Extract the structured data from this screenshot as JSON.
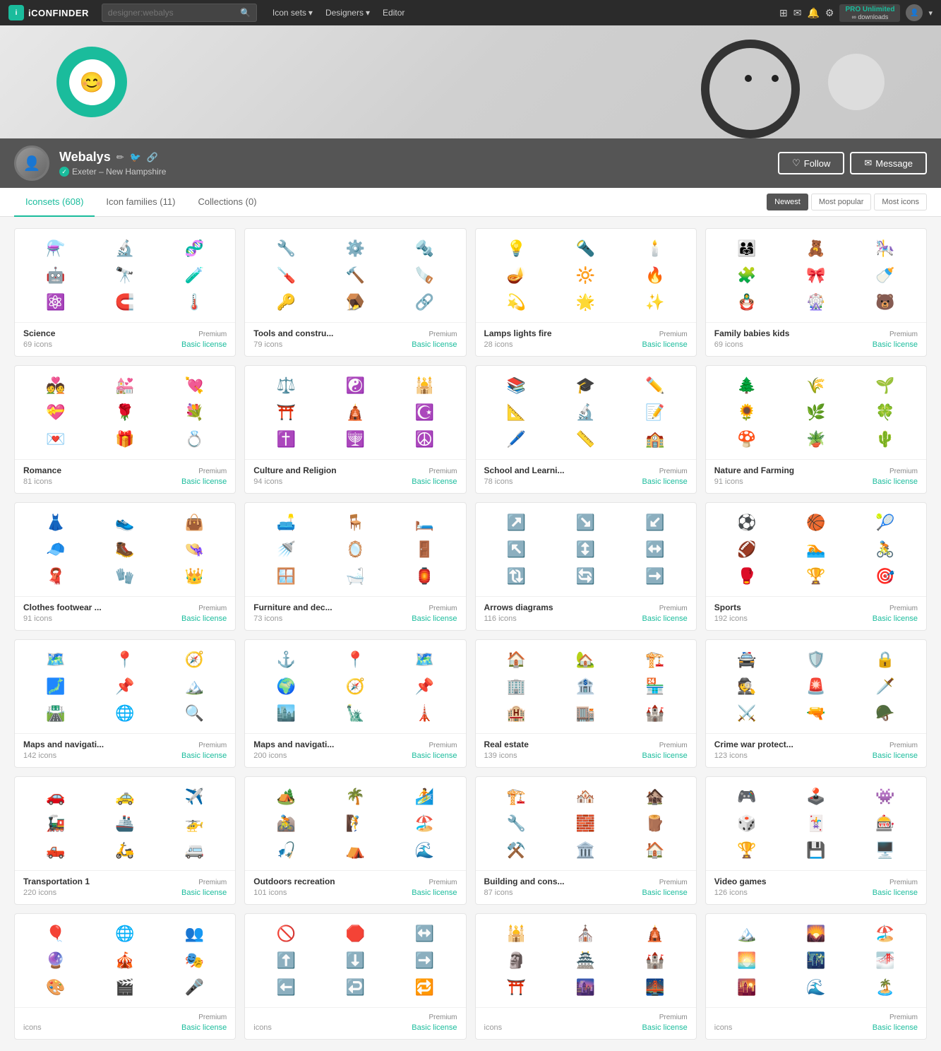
{
  "nav": {
    "logo": "iCONFINDER",
    "search_placeholder": "designer:webalys",
    "search_value": "designer:webalys",
    "links": [
      {
        "label": "Icon sets",
        "has_dropdown": true
      },
      {
        "label": "Designers",
        "has_dropdown": true
      },
      {
        "label": "Editor",
        "has_dropdown": false
      }
    ],
    "pro_label": "PRO Unlimited",
    "pro_sub": "∞ downloads"
  },
  "profile": {
    "name": "Webalys",
    "location": "Exeter – New Hampshire",
    "verified": true,
    "follow_label": "Follow",
    "message_label": "Message"
  },
  "tabs": [
    {
      "label": "Iconsets",
      "count": 608,
      "active": true
    },
    {
      "label": "Icon families",
      "count": 11,
      "active": false
    },
    {
      "label": "Collections",
      "count": 0,
      "active": false
    }
  ],
  "sort_options": [
    {
      "label": "Newest",
      "active": true
    },
    {
      "label": "Most popular",
      "active": false
    },
    {
      "label": "Most icons",
      "active": false
    }
  ],
  "icon_sets": [
    {
      "title": "Science",
      "badge": "Premium",
      "count": "69 icons",
      "license": "Basic license",
      "icons": [
        "⚗️",
        "🔬",
        "🧬",
        "🤖",
        "🔭",
        "🧪",
        "⚛️",
        "🧲",
        "🌡️"
      ]
    },
    {
      "title": "Tools and constru...",
      "badge": "Premium",
      "count": "79 icons",
      "license": "Basic license",
      "icons": [
        "🔧",
        "⚙️",
        "🔩",
        "🪛",
        "🔨",
        "🪚",
        "🔑",
        "🪤",
        "🔗"
      ]
    },
    {
      "title": "Lamps lights fire",
      "badge": "Premium",
      "count": "28 icons",
      "license": "Basic license",
      "icons": [
        "💡",
        "🔦",
        "🕯️",
        "🪔",
        "🔆",
        "🔥",
        "💫",
        "🌟",
        "✨"
      ]
    },
    {
      "title": "Family babies kids",
      "badge": "Premium",
      "count": "69 icons",
      "license": "Basic license",
      "icons": [
        "👨‍👩‍👧",
        "🧸",
        "🎠",
        "🧩",
        "🎀",
        "🍼",
        "🪆",
        "🎡",
        "🐻"
      ]
    },
    {
      "title": "Romance",
      "badge": "Premium",
      "count": "81 icons",
      "license": "Basic license",
      "icons": [
        "💑",
        "💒",
        "💘",
        "💝",
        "🌹",
        "💐",
        "💌",
        "🎁",
        "💍"
      ]
    },
    {
      "title": "Culture and Religion",
      "badge": "Premium",
      "count": "94 icons",
      "license": "Basic license",
      "icons": [
        "⚖️",
        "☯️",
        "🕌",
        "⛩️",
        "🛕",
        "☪️",
        "✝️",
        "🕎",
        "☮️"
      ]
    },
    {
      "title": "School and Learni...",
      "badge": "Premium",
      "count": "78 icons",
      "license": "Basic license",
      "icons": [
        "📚",
        "🎓",
        "✏️",
        "📐",
        "🔬",
        "📝",
        "🖊️",
        "📏",
        "🏫"
      ]
    },
    {
      "title": "Nature and Farming",
      "badge": "Premium",
      "count": "91 icons",
      "license": "Basic license",
      "icons": [
        "🌲",
        "🌾",
        "🌱",
        "🌻",
        "🌿",
        "🍀",
        "🍄",
        "🪴",
        "🌵"
      ]
    },
    {
      "title": "Clothes footwear ...",
      "badge": "Premium",
      "count": "91 icons",
      "license": "Basic license",
      "icons": [
        "👗",
        "👟",
        "👜",
        "🧢",
        "🥾",
        "👒",
        "🧣",
        "🧤",
        "👑"
      ]
    },
    {
      "title": "Furniture and dec...",
      "badge": "Premium",
      "count": "73 icons",
      "license": "Basic license",
      "icons": [
        "🛋️",
        "🪑",
        "🛏️",
        "🚿",
        "🪞",
        "🚪",
        "🪟",
        "🛁",
        "🏮"
      ]
    },
    {
      "title": "Arrows diagrams",
      "badge": "Premium",
      "count": "116 icons",
      "license": "Basic license",
      "icons": [
        "↗️",
        "↘️",
        "↙️",
        "↖️",
        "↕️",
        "↔️",
        "🔃",
        "🔄",
        "➡️"
      ]
    },
    {
      "title": "Sports",
      "badge": "Premium",
      "count": "192 icons",
      "license": "Basic license",
      "icons": [
        "⚽",
        "🏀",
        "🎾",
        "🏈",
        "🏊",
        "🚴",
        "🥊",
        "🏆",
        "🎯"
      ]
    },
    {
      "title": "Maps and navigati...",
      "badge": "Premium",
      "count": "142 icons",
      "license": "Basic license",
      "icons": [
        "🗺️",
        "📍",
        "🧭",
        "🗾",
        "📌",
        "🏔️",
        "🛣️",
        "🌐",
        "🔍"
      ]
    },
    {
      "title": "Maps and navigati...",
      "badge": "Premium",
      "count": "200 icons",
      "license": "Basic license",
      "icons": [
        "⚓",
        "📍",
        "🗺️",
        "🌍",
        "🧭",
        "📌",
        "🏙️",
        "🗽",
        "🗼"
      ]
    },
    {
      "title": "Real estate",
      "badge": "Premium",
      "count": "139 icons",
      "license": "Basic license",
      "icons": [
        "🏠",
        "🏡",
        "🏗️",
        "🏢",
        "🏦",
        "🏪",
        "🏨",
        "🏬",
        "🏰"
      ]
    },
    {
      "title": "Crime war protect...",
      "badge": "Premium",
      "count": "123 icons",
      "license": "Basic license",
      "icons": [
        "🚔",
        "🛡️",
        "🔒",
        "🕵️",
        "🚨",
        "🗡️",
        "⚔️",
        "🔫",
        "🪖"
      ]
    },
    {
      "title": "Transportation 1",
      "badge": "Premium",
      "count": "220 icons",
      "license": "Basic license",
      "icons": [
        "🚗",
        "🚕",
        "✈️",
        "🚂",
        "🚢",
        "🚁",
        "🛻",
        "🛵",
        "🚐"
      ]
    },
    {
      "title": "Outdoors recreation",
      "badge": "Premium",
      "count": "101 icons",
      "license": "Basic license",
      "icons": [
        "🏕️",
        "🌴",
        "🏄",
        "🚵",
        "🧗",
        "🏖️",
        "🎣",
        "⛺",
        "🌊"
      ]
    },
    {
      "title": "Building and cons...",
      "badge": "Premium",
      "count": "87 icons",
      "license": "Basic license",
      "icons": [
        "🏗️",
        "🏘️",
        "🏚️",
        "🔧",
        "🧱",
        "🪵",
        "⚒️",
        "🏛️",
        "🏠"
      ]
    },
    {
      "title": "Video games",
      "badge": "Premium",
      "count": "126 icons",
      "license": "Basic license",
      "icons": [
        "🎮",
        "🕹️",
        "👾",
        "🎲",
        "🃏",
        "🎰",
        "🏆",
        "💾",
        "🖥️"
      ]
    },
    {
      "title": "",
      "badge": "Premium",
      "count": "icons",
      "license": "Basic license",
      "icons": [
        "🎈",
        "🌐",
        "👥",
        "🔮",
        "🎪",
        "🎭",
        "🎨",
        "🎬",
        "🎤"
      ]
    },
    {
      "title": "",
      "badge": "Premium",
      "count": "icons",
      "license": "Basic license",
      "icons": [
        "🚫",
        "🛑",
        "↔️",
        "⬆️",
        "⬇️",
        "➡️",
        "⬅️",
        "↩️",
        "🔁"
      ]
    },
    {
      "title": "",
      "badge": "Premium",
      "count": "icons",
      "license": "Basic license",
      "icons": [
        "🕌",
        "⛪",
        "🛕",
        "🗿",
        "🏯",
        "🏰",
        "⛩️",
        "🌆",
        "🌉"
      ]
    },
    {
      "title": "",
      "badge": "Premium",
      "count": "icons",
      "license": "Basic license",
      "icons": [
        "🏔️",
        "🌄",
        "🏖️",
        "🌅",
        "🌃",
        "🌁",
        "🌇",
        "🌊",
        "🏝️"
      ]
    }
  ]
}
